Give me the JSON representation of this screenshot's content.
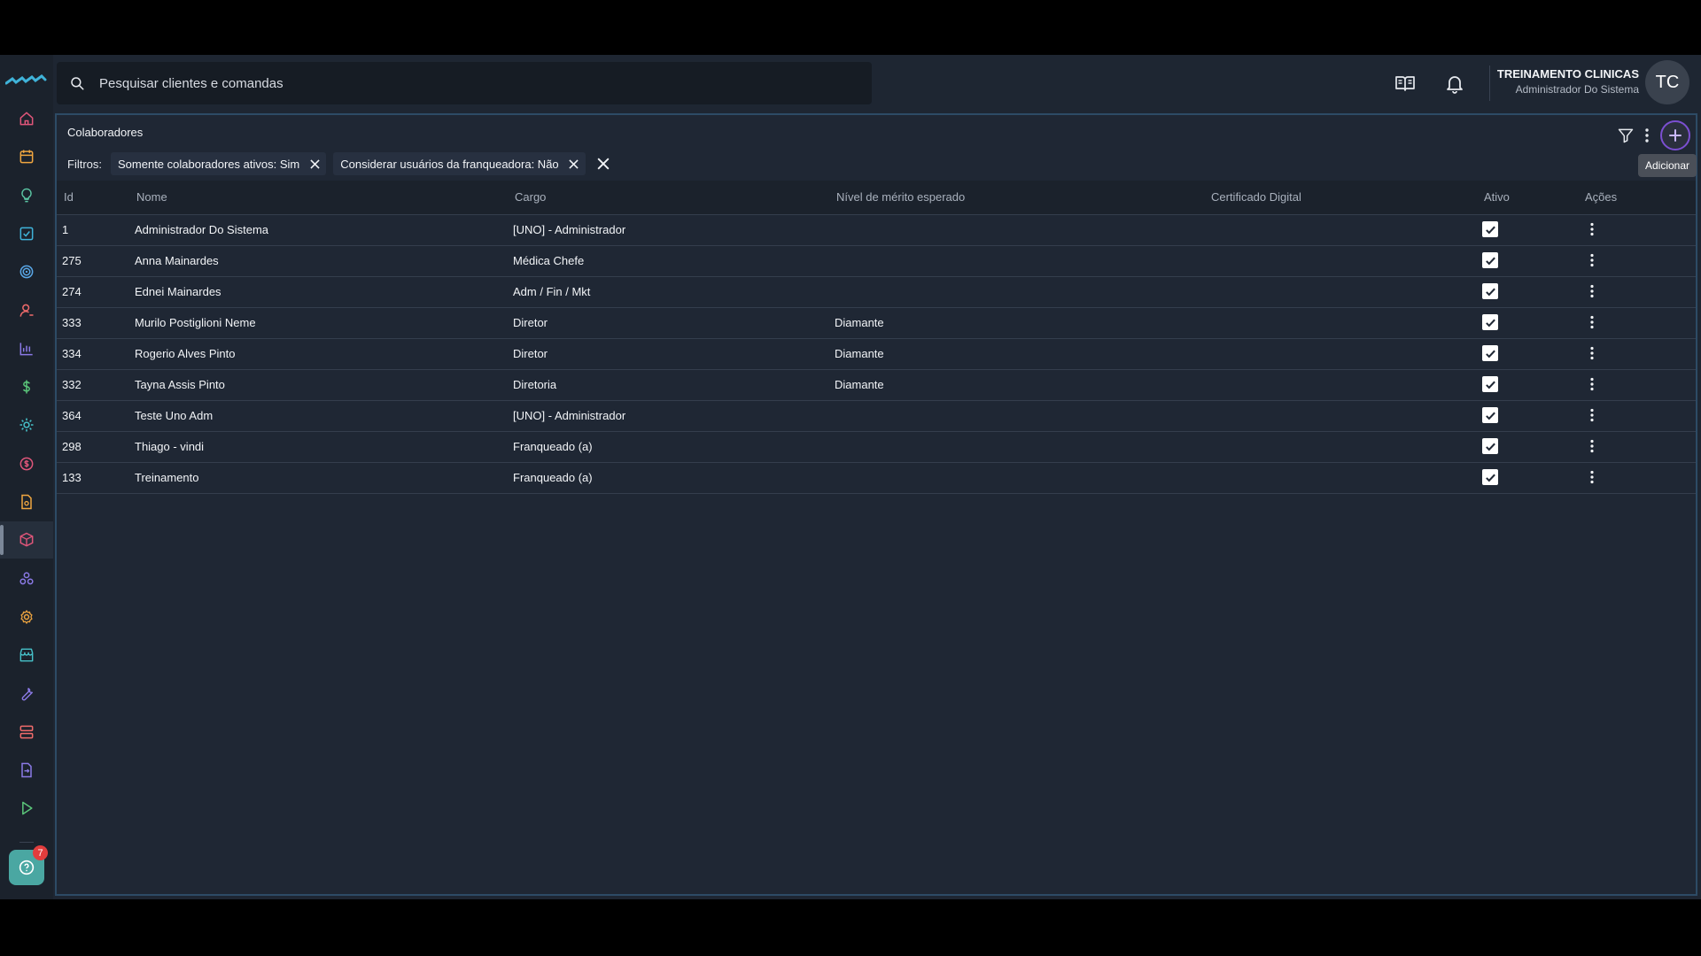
{
  "search": {
    "placeholder": "Pesquisar clientes e comandas"
  },
  "user": {
    "name": "TREINAMENTO CLINICAS",
    "role": "Administrador Do Sistema",
    "initials": "TC"
  },
  "sidebar": {
    "items": [
      {
        "icon": "home-icon",
        "color": "#e0567a"
      },
      {
        "icon": "calendar-icon",
        "color": "#f0a640"
      },
      {
        "icon": "lightbulb-icon",
        "color": "#5bc6a4"
      },
      {
        "icon": "checklist-icon",
        "color": "#3fb3d9"
      },
      {
        "icon": "target-icon",
        "color": "#5aa8e8"
      },
      {
        "icon": "user-icon",
        "color": "#f06b6b"
      },
      {
        "icon": "bar-chart-icon",
        "color": "#8b7ae6"
      },
      {
        "icon": "dollar-icon",
        "color": "#5bc67a"
      },
      {
        "icon": "settings-sun-icon",
        "color": "#46c1c9"
      },
      {
        "icon": "coin-icon",
        "color": "#e0567a"
      },
      {
        "icon": "document-gear-icon",
        "color": "#f0a640"
      },
      {
        "icon": "box-gear-icon",
        "color": "#e0567a"
      },
      {
        "icon": "hierarchy-icon",
        "color": "#8b7ae6"
      },
      {
        "icon": "gear-icon",
        "color": "#f0a640"
      },
      {
        "icon": "store-icon",
        "color": "#46c1c9"
      },
      {
        "icon": "wrench-icon",
        "color": "#8b7ae6"
      },
      {
        "icon": "server-icon",
        "color": "#f06b6b"
      },
      {
        "icon": "file-transfer-icon",
        "color": "#8b7ae6"
      },
      {
        "icon": "play-icon",
        "color": "#5bc67a"
      }
    ],
    "active_index": 11,
    "help_badge": "7"
  },
  "panel": {
    "title": "Colaboradores",
    "tooltip": "Adicionar",
    "filters_label": "Filtros:",
    "filters": [
      "Somente colaboradores ativos: Sim",
      "Considerar usuários da franqueadora: Não"
    ]
  },
  "table": {
    "columns": [
      "Id",
      "Nome",
      "Cargo",
      "Nível de mérito esperado",
      "Certificado Digital",
      "Ativo",
      "Ações"
    ],
    "rows": [
      {
        "id": "1",
        "nome": "Administrador Do Sistema",
        "cargo": "[UNO] - Administrador",
        "nivel": "",
        "cert": "",
        "ativo": true
      },
      {
        "id": "275",
        "nome": "Anna Mainardes",
        "cargo": "Médica Chefe",
        "nivel": "",
        "cert": "",
        "ativo": true
      },
      {
        "id": "274",
        "nome": "Ednei Mainardes",
        "cargo": "Adm / Fin / Mkt",
        "nivel": "",
        "cert": "",
        "ativo": true
      },
      {
        "id": "333",
        "nome": "Murilo Postiglioni Neme",
        "cargo": "Diretor",
        "nivel": "Diamante",
        "cert": "",
        "ativo": true
      },
      {
        "id": "334",
        "nome": "Rogerio Alves Pinto",
        "cargo": "Diretor",
        "nivel": "Diamante",
        "cert": "",
        "ativo": true
      },
      {
        "id": "332",
        "nome": "Tayna Assis Pinto",
        "cargo": "Diretoria",
        "nivel": "Diamante",
        "cert": "",
        "ativo": true
      },
      {
        "id": "364",
        "nome": "Teste Uno Adm",
        "cargo": "[UNO] - Administrador",
        "nivel": "",
        "cert": "",
        "ativo": true
      },
      {
        "id": "298",
        "nome": "Thiago - vindi",
        "cargo": "Franqueado (a)",
        "nivel": "",
        "cert": "",
        "ativo": true
      },
      {
        "id": "133",
        "nome": "Treinamento",
        "cargo": "Franqueado (a)",
        "nivel": "",
        "cert": "",
        "ativo": true
      }
    ]
  }
}
